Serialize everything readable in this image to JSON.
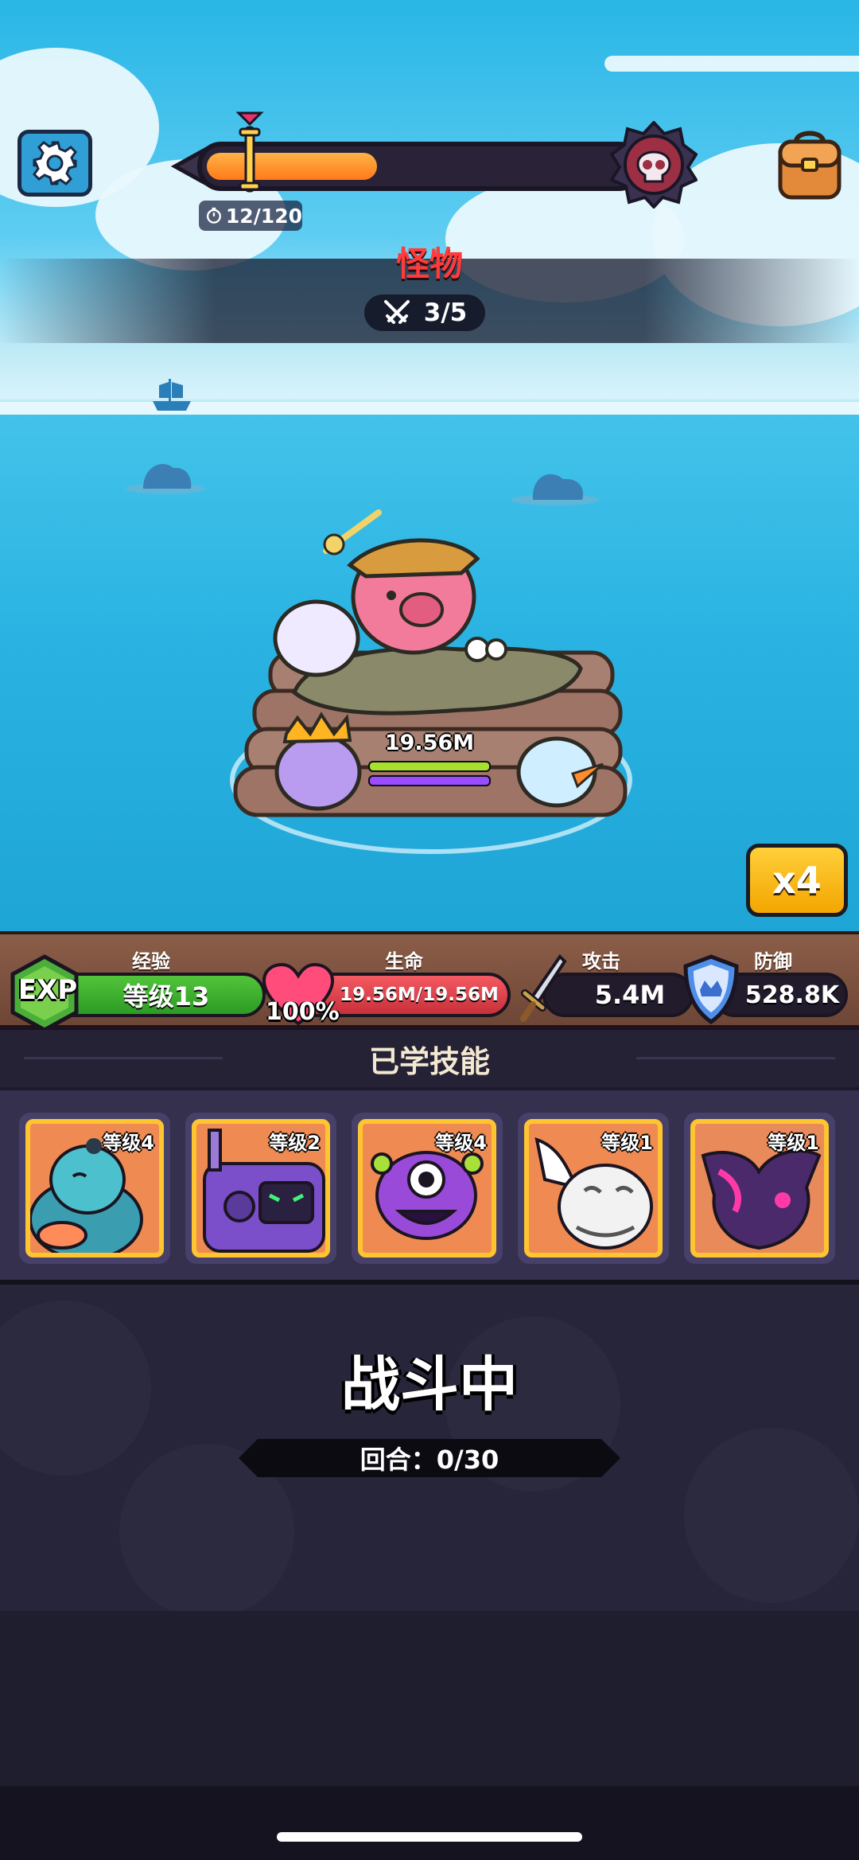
{
  "hud": {
    "timer": "12/120",
    "wave_progress": 0.4,
    "stage_title": "怪物",
    "wave_counter": "3/5",
    "speed_button": "x4"
  },
  "battle": {
    "team_hp_label": "19.56M",
    "team_hp_fraction": 1.0
  },
  "stats": {
    "exp": {
      "label": "经验",
      "badge": "EXP",
      "value": "等级13"
    },
    "hp": {
      "label": "生命",
      "percent": "100%",
      "value": "19.56M/19.56M"
    },
    "attack": {
      "label": "攻击",
      "value": "5.4M"
    },
    "defense": {
      "label": "防御",
      "value": "528.8K"
    }
  },
  "skills": {
    "header": "已学技能",
    "items": [
      {
        "level": "等级4",
        "icon": "ogre-icon"
      },
      {
        "level": "等级2",
        "icon": "robot-icon"
      },
      {
        "level": "等级4",
        "icon": "eye-monster-icon"
      },
      {
        "level": "等级1",
        "icon": "white-tiger-icon"
      },
      {
        "level": "等级1",
        "icon": "dark-dragon-icon"
      }
    ]
  },
  "status": {
    "title": "战斗中",
    "round": "回合：0/30"
  },
  "colors": {
    "wave_title": "#ff3b3b",
    "progress": "#ff8a1f",
    "exp_bar": "#3fb02c",
    "hp_bar": "#e0404b",
    "skill_border": "#ffc531"
  }
}
